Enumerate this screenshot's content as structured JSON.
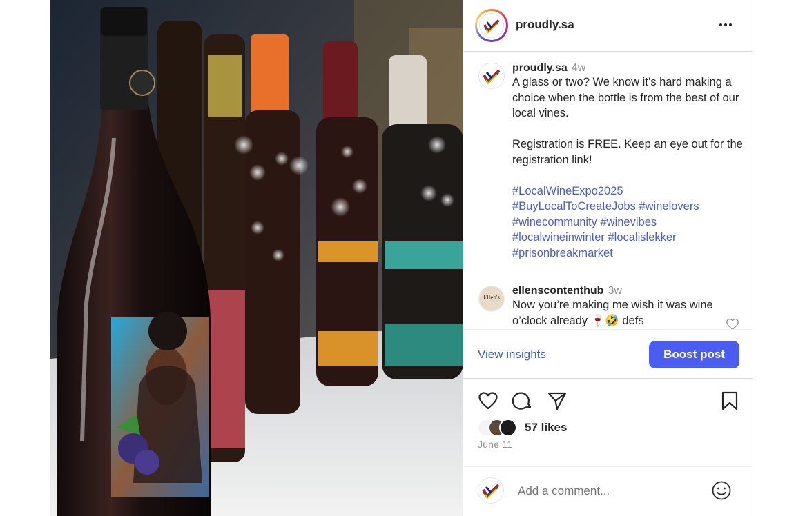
{
  "account": {
    "username": "proudly.sa"
  },
  "caption": {
    "username": "proudly.sa",
    "time": "4w",
    "paragraphs": [
      "A glass or two? We know it’s hard making a choice when the bottle is from the best of our local vines.",
      "Registration is FREE. Keep an eye out for the registration link!"
    ],
    "hashtags": [
      "#LocalWineExpo2025",
      "#BuyLocalToCreateJobs",
      "#winelovers",
      "#winecommunity",
      "#winevibes",
      "#localwineinwinter",
      "#localislekker",
      "#prisonbreakmarket"
    ]
  },
  "comments": [
    {
      "username": "ellenscontenthub",
      "time": "3w",
      "text": "Now you’re making me wish it was wine o’clock already 🍷🤣 defs",
      "avatar_text": "Ellen's"
    }
  ],
  "insights": {
    "view_label": "View insights",
    "boost_label": "Boost post"
  },
  "engagement": {
    "likes": "57 likes",
    "date": "June 11"
  },
  "comment_box": {
    "placeholder": "Add a comment..."
  },
  "icons": {
    "more": "more-options-icon",
    "like": "heart-icon",
    "comment": "comment-icon",
    "share": "share-icon",
    "save": "bookmark-icon",
    "emoji": "emoji-icon"
  },
  "colors": {
    "accent": "#4a5df0",
    "hashtag": "#4a5fc1",
    "muted": "#8e8e8e",
    "border": "#dbdbdb"
  }
}
